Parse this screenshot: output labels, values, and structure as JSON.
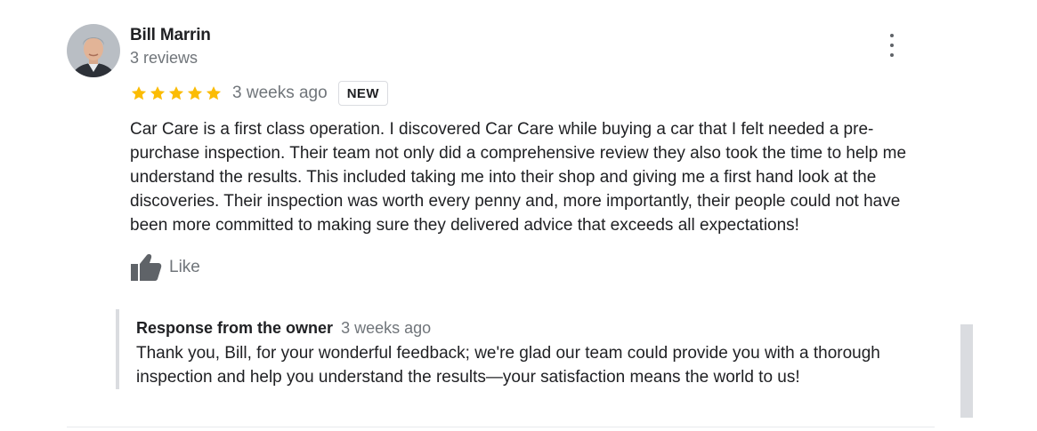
{
  "review": {
    "author_name": "Bill Marrin",
    "author_review_count": "3 reviews",
    "rating": 5,
    "rating_max": 5,
    "time_ago": "3 weeks ago",
    "badge": "NEW",
    "text": "Car Care is a first class operation. I discovered Car Care while buying a car that I felt needed a pre-purchase inspection. Their team not only did a comprehensive review they also took the time to help me understand the results. This included taking me into their shop and giving me a first hand look at the discoveries. Their inspection was worth every penny and, more importantly, their people could not have been more committed to making sure they delivered advice that exceeds all expectations!",
    "like_label": "Like"
  },
  "owner_response": {
    "title": "Response from the owner",
    "time_ago": "3 weeks ago",
    "text": "Thank you, Bill, for your wonderful feedback; we're glad our team could provide you with a thorough inspection and help you understand the results—your satisfaction means the world to us!"
  },
  "icons": {
    "avatar": "avatar",
    "more": "more-vert-icon",
    "star": "star-icon",
    "like": "thumbs-up-icon"
  },
  "colors": {
    "star": "#fbbc04",
    "primary_text": "#202124",
    "secondary_text": "#70757a",
    "border": "#dadce0",
    "icon": "#5f6368"
  }
}
